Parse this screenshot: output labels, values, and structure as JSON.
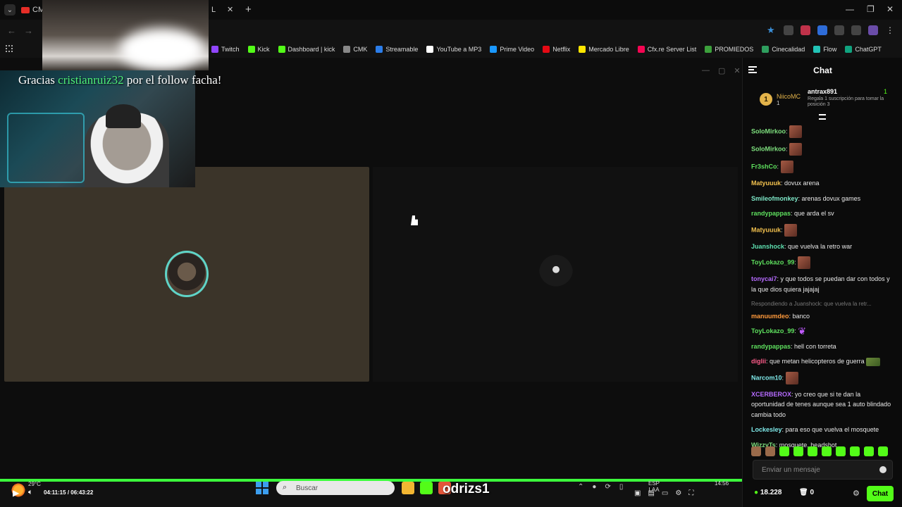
{
  "browser": {
    "tabs": [
      {
        "label": "CM"
      },
      {
        "label": "L"
      }
    ],
    "bookmarks": [
      {
        "label": "Twitch",
        "color": "#9146ff"
      },
      {
        "label": "Kick",
        "color": "#53fc18"
      },
      {
        "label": "Dashboard | kick",
        "color": "#53fc18"
      },
      {
        "label": "CMK",
        "color": "#888888"
      },
      {
        "label": "Streamable",
        "color": "#2b7de9"
      },
      {
        "label": "YouTube a MP3",
        "color": "#ffffff"
      },
      {
        "label": "Prime Video",
        "color": "#1a98ff"
      },
      {
        "label": "Netflix",
        "color": "#e50914"
      },
      {
        "label": "Mercado Libre",
        "color": "#ffe600"
      },
      {
        "label": "Cfx.re Server List",
        "color": "#f40552"
      },
      {
        "label": "PROMIEDOS",
        "color": "#3ca03c"
      },
      {
        "label": "Cinecalidad",
        "color": "#2e9e5e"
      },
      {
        "label": "Flow",
        "color": "#22c3b6"
      },
      {
        "label": "ChatGPT",
        "color": "#10a37f"
      }
    ]
  },
  "stream": {
    "follow_prefix": "Gracias",
    "follow_user": "cristianruiz32",
    "follow_suffix": "por el follow facha!",
    "overlay_name": "odrizs1"
  },
  "player": {
    "weather": "29°C",
    "time_current": "04:11:15",
    "time_total": "06:43:22",
    "search_placeholder": "Buscar",
    "lang": "ESP",
    "lang_sub": "LAA",
    "clock": "14:56"
  },
  "chat": {
    "title": "Chat",
    "leaderboard": [
      {
        "rank": "1",
        "name": "NiicoMC",
        "count": "1"
      },
      {
        "name": "antrax891",
        "count": "1",
        "note": "Regala 1 suscripción para tomar la posición 3"
      }
    ],
    "messages": [
      {
        "user": "SoloMirkoo",
        "color": "#7ee07e",
        "text": "",
        "emote": "face"
      },
      {
        "user": "SoloMirkoo",
        "color": "#7ee07e",
        "text": "",
        "emote": "face"
      },
      {
        "user": "Fr3shCo",
        "color": "#5ee05e",
        "text": "",
        "emote": "face"
      },
      {
        "user": "Matyuuuk",
        "color": "#f2c14e",
        "text": "dovux arena"
      },
      {
        "user": "Smileofmonkey",
        "color": "#7ee8c8",
        "text": "arenas dovux games"
      },
      {
        "user": "randypappas",
        "color": "#5ee05e",
        "text": "que arda el sv"
      },
      {
        "user": "Matyuuuk",
        "color": "#f2c14e",
        "text": "",
        "emote": "face"
      },
      {
        "user": "Juanshock",
        "color": "#5ee0b0",
        "text": "que vuelva la retro war"
      },
      {
        "user": "ToyLokazo_99",
        "color": "#5ee05e",
        "text": "",
        "emote": "face"
      },
      {
        "user": "tonycai7",
        "color": "#b66bff",
        "text": "y que todos se puedan dar con todos y la que dios quiera jajajaj"
      },
      {
        "reply": "Respondiendo a Juanshock: que vuelva la retr...",
        "user": "manuumdeo",
        "color": "#ff9a3c",
        "text": "banco"
      },
      {
        "user": "ToyLokazo_99",
        "color": "#5ee05e",
        "text": "",
        "emote": "butterfly"
      },
      {
        "user": "randypappas",
        "color": "#5ee05e",
        "text": "hell con torreta"
      },
      {
        "user": "diglii",
        "color": "#ff5c8a",
        "text": "que metan helicopteros de guerra",
        "emote": "tank"
      },
      {
        "user": "Narcom10",
        "color": "#7ee8e8",
        "text": "",
        "emote": "face"
      },
      {
        "user": "XCERBEROX",
        "color": "#b66bff",
        "text": "yo creo que si te dan la oportunidad de tenes aunque sea 1 auto blindado cambia todo"
      },
      {
        "user": "Lockesley",
        "color": "#7ee8e8",
        "text": "para eso que vuelva el mosquete"
      },
      {
        "user": "WizzyTs",
        "color": "#7ee07e",
        "text": "mosquete, headshot"
      }
    ],
    "input_placeholder": "Enviar un mensaje",
    "points": "18.228",
    "trash_count": "0",
    "send_label": "Chat"
  }
}
